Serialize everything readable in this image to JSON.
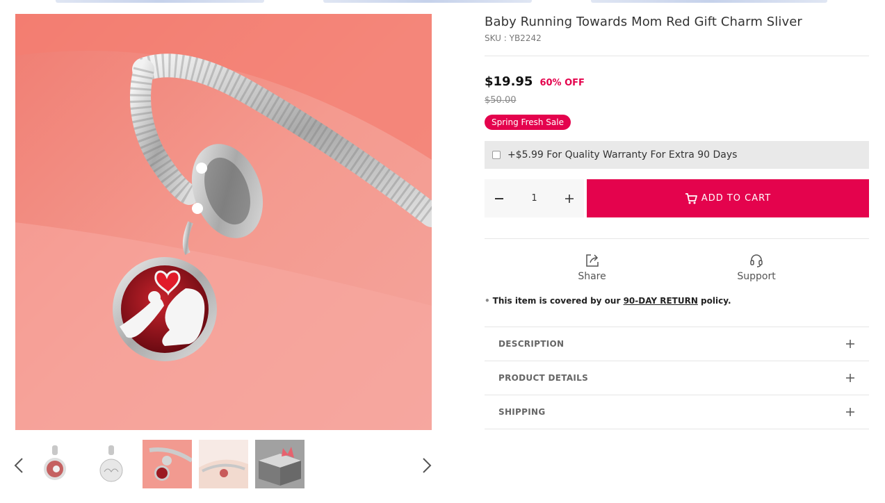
{
  "product": {
    "title": "Baby Running Towards Mom Red Gift Charm Sliver",
    "sku": "SKU : YB2242",
    "price": "$19.95",
    "discount": "60% OFF",
    "old_price": "$50.00",
    "sale_badge": "Spring Fresh Sale"
  },
  "warranty": {
    "label": "+$5.99 For Quality Warranty For Extra 90 Days",
    "checked": false
  },
  "cart": {
    "quantity": "1",
    "add_to_cart_label": "ADD TO CART"
  },
  "actions": {
    "share_label": "Share",
    "support_label": "Support"
  },
  "policy": {
    "prefix": "This item is covered by our",
    "link": "90-DAY RETURN",
    "suffix": "policy."
  },
  "accordion": [
    {
      "label": "DESCRIPTION"
    },
    {
      "label": "PRODUCT DETAILS"
    },
    {
      "label": "SHIPPING"
    }
  ],
  "gallery": {
    "selected_index": 2,
    "thumbnails": [
      "charm-front",
      "charm-mom-back",
      "charm-on-bracelet",
      "charm-on-wrist",
      "gift-box"
    ]
  },
  "colors": {
    "accent": "#e4034d",
    "warranty_bg": "#e9e9e9"
  },
  "icons": {
    "prev": "chevron-left-icon",
    "next": "chevron-right-icon",
    "cart": "cart-icon",
    "share": "share-icon",
    "support": "headset-icon",
    "expand": "plus-icon"
  }
}
